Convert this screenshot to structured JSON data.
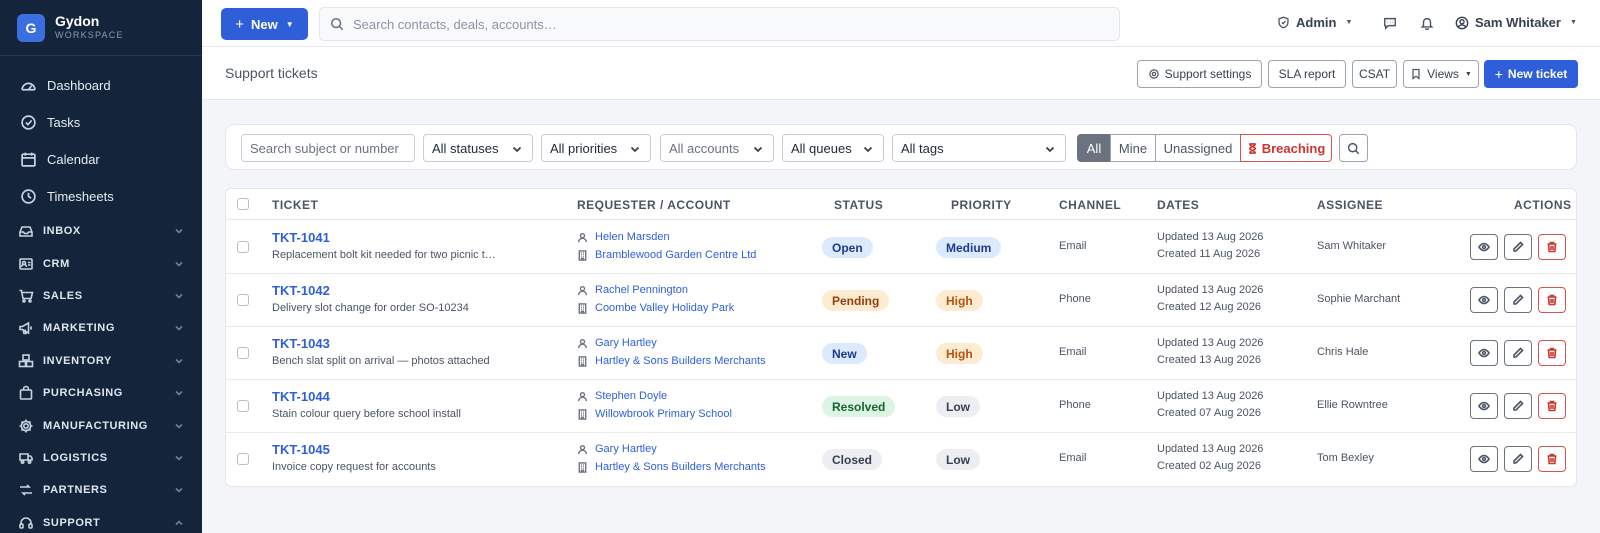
{
  "brand": {
    "initial": "G",
    "name": "Gydon",
    "sub": "WORKSPACE"
  },
  "sidebar": {
    "items": [
      {
        "label": "Dashboard",
        "icon": "dashboard-icon"
      },
      {
        "label": "Tasks",
        "icon": "tasks-icon"
      },
      {
        "label": "Calendar",
        "icon": "calendar-icon"
      },
      {
        "label": "Timesheets",
        "icon": "clock-icon"
      }
    ],
    "sections": [
      {
        "label": "INBOX",
        "icon": "inbox-icon"
      },
      {
        "label": "CRM",
        "icon": "contacts-icon"
      },
      {
        "label": "SALES",
        "icon": "cart-icon"
      },
      {
        "label": "MARKETING",
        "icon": "megaphone-icon"
      },
      {
        "label": "INVENTORY",
        "icon": "boxes-icon"
      },
      {
        "label": "PURCHASING",
        "icon": "bag-icon"
      },
      {
        "label": "MANUFACTURING",
        "icon": "gear-icon"
      },
      {
        "label": "LOGISTICS",
        "icon": "truck-icon"
      },
      {
        "label": "PARTNERS",
        "icon": "handshake-icon"
      },
      {
        "label": "SUPPORT",
        "icon": "headset-icon"
      }
    ]
  },
  "topbar": {
    "new_label": "New",
    "search_placeholder": "Search contacts, deals, accounts…",
    "role": "Admin",
    "user": "Sam Whitaker"
  },
  "header": {
    "title": "Support tickets",
    "buttons": {
      "support_settings": "Support settings",
      "sla_report": "SLA report",
      "csat": "CSAT",
      "views": "Views",
      "new_ticket": "New ticket"
    }
  },
  "filters": {
    "search_placeholder": "Search subject or number",
    "status": "All statuses",
    "priority": "All priorities",
    "accounts": "All accounts",
    "queues": "All queues",
    "tags": "All tags",
    "segments": {
      "all": "All",
      "mine": "Mine",
      "unassigned": "Unassigned",
      "breaching": "Breaching"
    }
  },
  "table": {
    "columns": {
      "ticket": "TICKET",
      "requester": "REQUESTER / ACCOUNT",
      "status": "STATUS",
      "priority": "PRIORITY",
      "channel": "CHANNEL",
      "dates": "DATES",
      "assignee": "ASSIGNEE",
      "actions": "ACTIONS"
    },
    "rows": [
      {
        "id": "TKT-1041",
        "subject": "Replacement bolt kit needed for two picnic tables at the cafe terrace",
        "requester": "Helen Marsden",
        "account": "Bramblewood Garden Centre Ltd",
        "status": "Open",
        "priority": "Medium",
        "channel": "Email",
        "updated": "Updated 13 Aug 2026",
        "created": "Created 11 Aug 2026",
        "assignee": "Sam Whitaker"
      },
      {
        "id": "TKT-1042",
        "subject": "Delivery slot change for order SO-10234",
        "requester": "Rachel Pennington",
        "account": "Coombe Valley Holiday Park",
        "status": "Pending",
        "priority": "High",
        "channel": "Phone",
        "updated": "Updated 13 Aug 2026",
        "created": "Created 12 Aug 2026",
        "assignee": "Sophie Marchant"
      },
      {
        "id": "TKT-1043",
        "subject": "Bench slat split on arrival — photos attached",
        "requester": "Gary Hartley",
        "account": "Hartley & Sons Builders Merchants",
        "status": "New",
        "priority": "High",
        "channel": "Email",
        "updated": "Updated 13 Aug 2026",
        "created": "Created 13 Aug 2026",
        "assignee": "Chris Hale"
      },
      {
        "id": "TKT-1044",
        "subject": "Stain colour query before school install",
        "requester": "Stephen Doyle",
        "account": "Willowbrook Primary School",
        "status": "Resolved",
        "priority": "Low",
        "channel": "Phone",
        "updated": "Updated 13 Aug 2026",
        "created": "Created 07 Aug 2026",
        "assignee": "Ellie Rowntree"
      },
      {
        "id": "TKT-1045",
        "subject": "Invoice copy request for accounts",
        "requester": "Gary Hartley",
        "account": "Hartley & Sons Builders Merchants",
        "status": "Closed",
        "priority": "Low",
        "channel": "Email",
        "updated": "Updated 13 Aug 2026",
        "created": "Created 02 Aug 2026",
        "assignee": "Tom Bexley"
      }
    ]
  },
  "colors": {
    "sidebar_bg": "#13243b",
    "primary": "#2f5fd8",
    "danger": "#d0342c",
    "status_open": "#dbeafe",
    "status_pending": "#fdebd2",
    "status_new": "#dbeafe",
    "status_resolved": "#dcf5e3",
    "status_closed": "#eceef1"
  }
}
